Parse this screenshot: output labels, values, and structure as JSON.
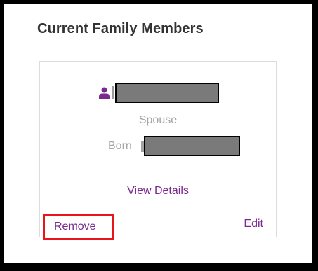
{
  "section": {
    "title": "Current Family Members"
  },
  "member_card": {
    "relationship": "Spouse",
    "born_label": "Born",
    "view_details_label": "View Details",
    "remove_label": "Remove",
    "edit_label": "Edit"
  },
  "colors": {
    "accent": "#7a2a8c",
    "highlight": "#e8151c",
    "muted_text": "#a3a3a3",
    "redaction": "#7a7a7a"
  },
  "icons": {
    "person": "person-icon"
  }
}
